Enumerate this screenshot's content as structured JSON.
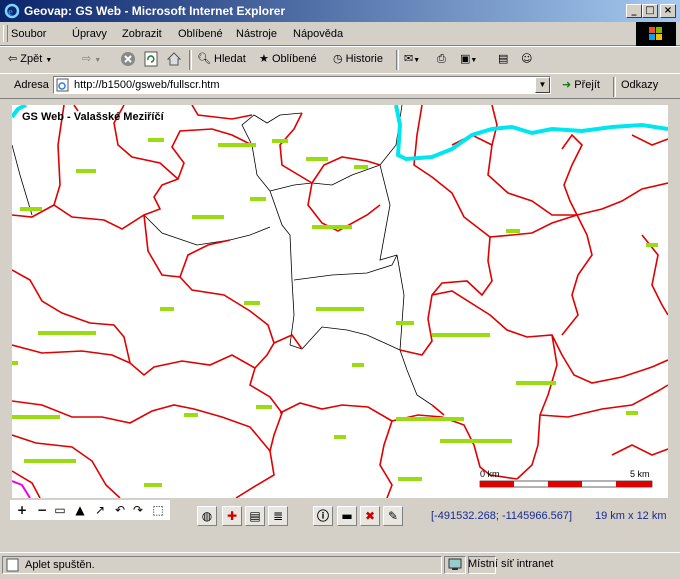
{
  "window": {
    "title": "Geovap: GS Web - Microsoft Internet Explorer"
  },
  "menu": [
    "Soubor",
    "Úpravy",
    "Zobrazit",
    "Oblíbené",
    "Nástroje",
    "Nápověda"
  ],
  "toolbar": {
    "back": "Zpět",
    "search": "Hledat",
    "favorites": "Oblíbené",
    "history": "Historie"
  },
  "address": {
    "label": "Adresa",
    "url": "http://b1500/gsweb/fullscr.htm",
    "go": "Přejít",
    "links": "Odkazy"
  },
  "map": {
    "title": "GS Web - Valašské Meziříčí",
    "scale_start": "0 km",
    "scale_end": "5 km",
    "coordinates": "[-491532.268; -1145966.567]",
    "extent": "19 km x 12 km",
    "colors": {
      "roads": "#e00000",
      "boundaries": "#000000",
      "river": "#00e6f0",
      "labels": "#99dd11",
      "border": "#ee00ee"
    }
  },
  "status": {
    "text": "Aplet spuštěn.",
    "zone": "Místní síť intranet"
  }
}
